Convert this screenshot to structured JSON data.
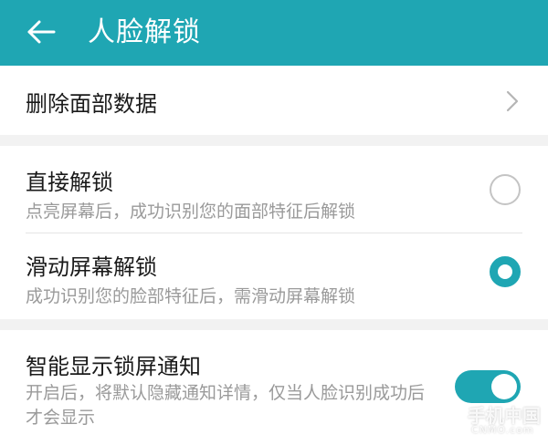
{
  "header": {
    "title": "人脸解锁",
    "back_icon": "arrow-left-icon"
  },
  "delete_face": {
    "label": "删除面部数据",
    "chevron_icon": "chevron-right-icon"
  },
  "unlock_mode": {
    "options": [
      {
        "title": "直接解锁",
        "subtitle": "点亮屏幕后，成功识别您的面部特征后解锁",
        "selected": false
      },
      {
        "title": "滑动屏幕解锁",
        "subtitle": "成功识别您的脸部特征后，需滑动屏幕解锁",
        "selected": true
      }
    ]
  },
  "lock_notification": {
    "title": "智能显示锁屏通知",
    "subtitle": "开启后，将默认隐藏通知详情，仅当人脸识别成功后才会显示",
    "enabled": true
  },
  "watermark": {
    "text": "手机中国",
    "subtext": "CNMO.com"
  },
  "colors": {
    "accent": "#1fa6b3",
    "background": "#f2f2f2",
    "card": "#ffffff",
    "primary_text": "#1a1a1a",
    "secondary_text": "#9a9a9a"
  }
}
